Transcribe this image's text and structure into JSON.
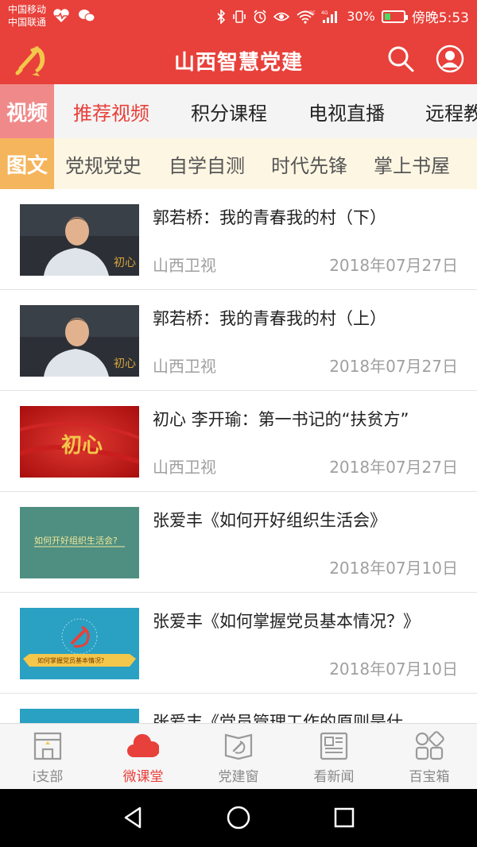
{
  "status_bar": {
    "carrier_1": "中国移动",
    "carrier_2": "中国联通",
    "left_icons": [
      "heart-monitor-icon",
      "wechat-icon"
    ],
    "right_icons": [
      "bluetooth-icon",
      "vibrate-icon",
      "alarm-icon",
      "eye-icon",
      "wifi-icon",
      "signal-icon"
    ],
    "network_1": "2G",
    "network_2": "4G",
    "battery_percent": "30%",
    "battery_level": 0.3,
    "time": "傍晚5:53"
  },
  "header": {
    "title": "山西智慧党建",
    "logo_icon": "party-emblem-icon",
    "search_icon": "search-icon",
    "user_icon": "user-icon"
  },
  "video_row": {
    "label": "视频",
    "tabs": [
      "推荐视频",
      "积分课程",
      "电视直播",
      "远程教"
    ]
  },
  "text_row": {
    "label": "图文",
    "tabs": [
      "党规党史",
      "自学自测",
      "时代先锋",
      "掌上书屋"
    ]
  },
  "list": [
    {
      "title": "郭若桥：我的青春我的村（下）",
      "source": "山西卫视",
      "date": "2018年07月27日",
      "thumb_text": "初心"
    },
    {
      "title": "郭若桥：我的青春我的村（上）",
      "source": "山西卫视",
      "date": "2018年07月27日",
      "thumb_text": "初心"
    },
    {
      "title": "初心 李开瑜：第一书记的“扶贫方”",
      "source": "山西卫视",
      "date": "2018年07月27日",
      "thumb_text": "初心"
    },
    {
      "title": "张爱丰《如何开好组织生活会》",
      "source": "",
      "date": "2018年07月10日",
      "thumb_text": "如何开好组织生活会?"
    },
    {
      "title": "张爱丰《如何掌握党员基本情况？》",
      "source": "",
      "date": "2018年07月10日",
      "thumb_text": "如何掌握党员基本情况?"
    },
    {
      "title": "张爱丰《党员管理工作的原则是什",
      "source": "",
      "date": "",
      "thumb_text": ""
    }
  ],
  "bottom_nav": [
    {
      "label": "i支部",
      "icon": "store-icon"
    },
    {
      "label": "微课堂",
      "icon": "cloud-icon"
    },
    {
      "label": "党建窗",
      "icon": "party-flag-icon"
    },
    {
      "label": "看新闻",
      "icon": "newspaper-icon"
    },
    {
      "label": "百宝箱",
      "icon": "grid-icon"
    }
  ],
  "system_nav": {
    "back_icon": "back-triangle-icon",
    "home_icon": "home-circle-icon",
    "recents_icon": "recents-square-icon"
  },
  "colors": {
    "brand_red": "#e8403a",
    "video_label_bg": "#f08a8a",
    "text_label_bg": "#f5b55d",
    "gold": "#f3c74b"
  }
}
